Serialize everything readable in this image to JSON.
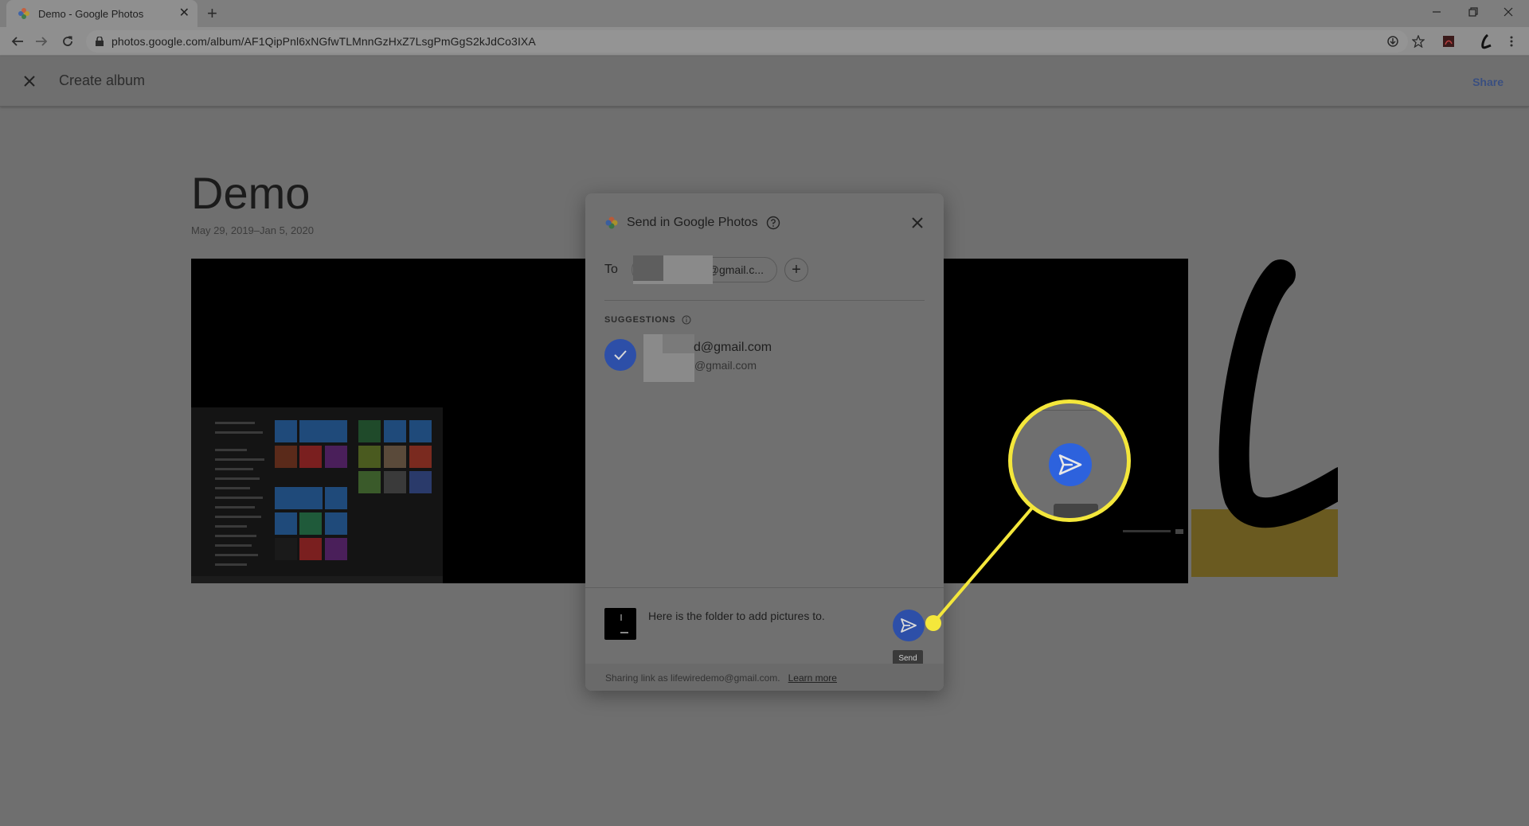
{
  "browser": {
    "tab_title": "Demo - Google Photos",
    "url": "photos.google.com/album/AF1QipPnl6xNGfwTLMnnGzHxZ7LsgPmGgS2kJdCo3IXA"
  },
  "app": {
    "header_title": "Create album",
    "share_label": "Share"
  },
  "album": {
    "title": "Demo",
    "dates": "May 29, 2019–Jan 5, 2020"
  },
  "dialog": {
    "title": "Send in Google Photos",
    "to_label": "To",
    "recipient_chip": "@gmail.c...",
    "suggestions_heading": "SUGGESTIONS",
    "suggestion_email": "d@gmail.com",
    "suggestion_secondary": "@gmail.com",
    "message": "Here is the folder to add pictures to.",
    "send_tooltip": "Send",
    "sharing_text": "Sharing link as lifewiredemo@gmail.com.",
    "learn_more": "Learn more"
  },
  "colors": {
    "accent_blue": "#2d62dd",
    "highlight_yellow": "#f4e73b"
  }
}
